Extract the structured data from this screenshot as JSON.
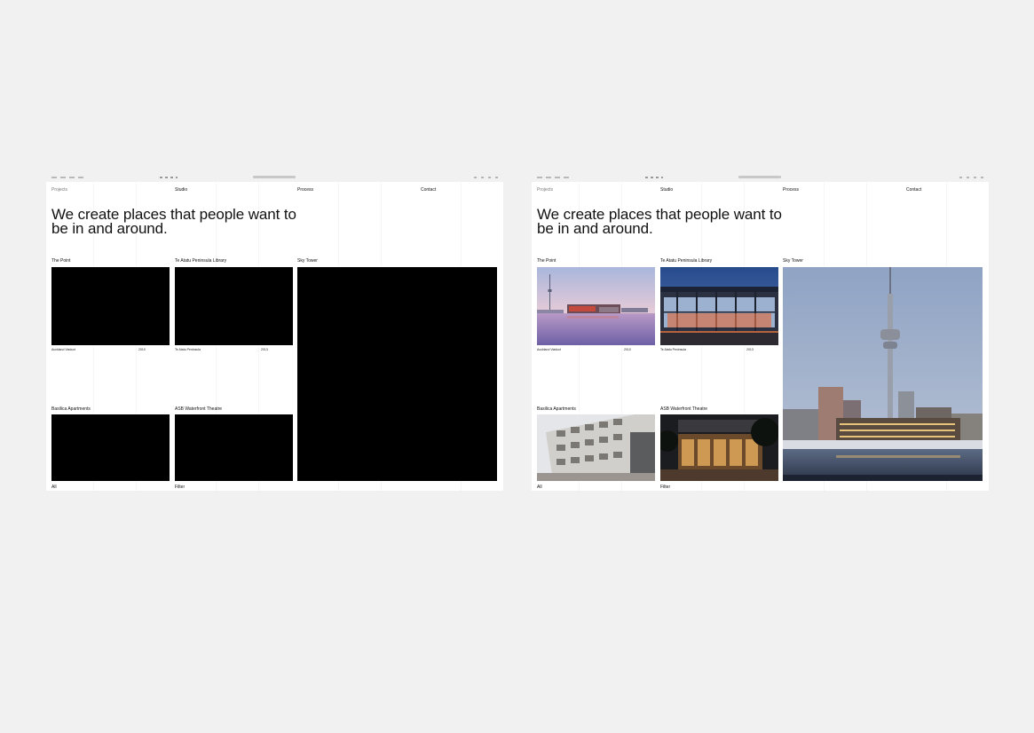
{
  "nav": [
    "Projects",
    "Studio",
    "Process",
    "Contact"
  ],
  "hero": {
    "line1": "We create places that people want to",
    "line2": "be in and around."
  },
  "projects": [
    {
      "title": "The Point",
      "location": "Auckland Viaduct",
      "year": "2010"
    },
    {
      "title": "Te Atatu Peninsula Library",
      "location": "Te Atatu Peninsula",
      "year": "2013"
    },
    {
      "title": "Sky Tower"
    },
    {
      "title": "Basilica Apartments"
    },
    {
      "title": "ASB Waterfront Theatre"
    }
  ],
  "footer": {
    "all": "All",
    "filter": "Filter"
  },
  "colors": {
    "background": "#f1f1f1",
    "page": "#ffffff",
    "placeholder": "#000000"
  },
  "screens": [
    "loading-state",
    "loaded-state"
  ]
}
